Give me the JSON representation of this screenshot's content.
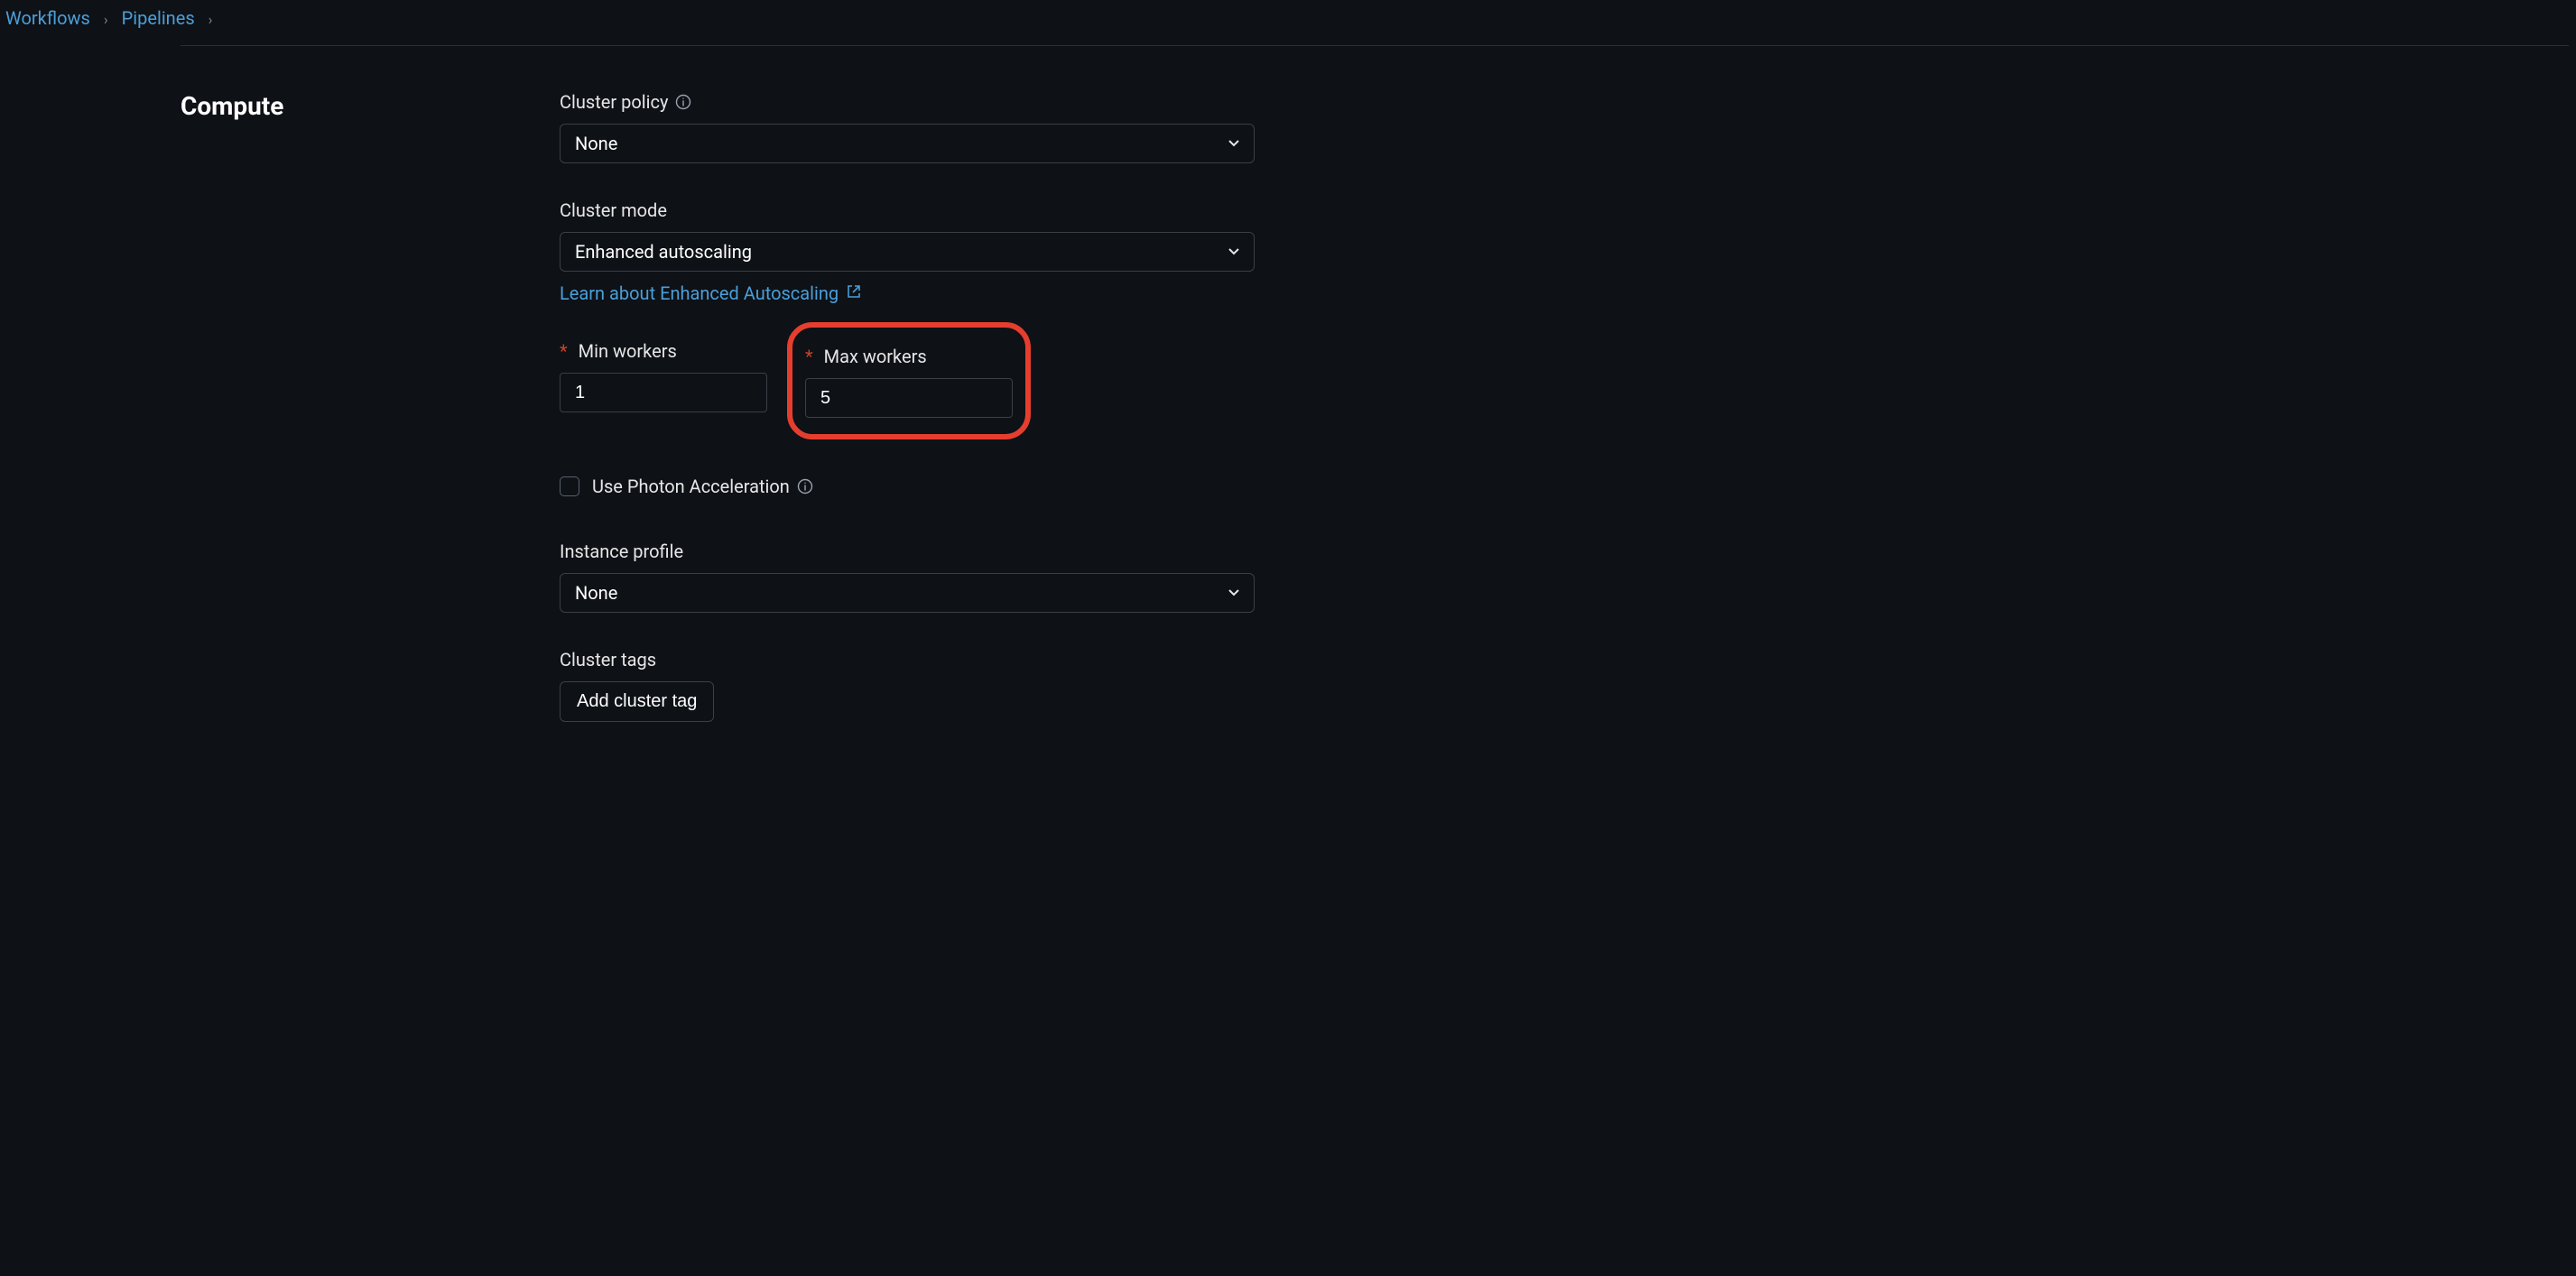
{
  "breadcrumb": {
    "items": [
      "Workflows",
      "Pipelines"
    ]
  },
  "section_title": "Compute",
  "cluster_policy": {
    "label": "Cluster policy",
    "value": "None"
  },
  "cluster_mode": {
    "label": "Cluster mode",
    "value": "Enhanced autoscaling",
    "link_text": "Learn about Enhanced Autoscaling"
  },
  "min_workers": {
    "label": "Min workers",
    "value": "1"
  },
  "max_workers": {
    "label": "Max workers",
    "value": "5"
  },
  "photon": {
    "label": "Use Photon Acceleration"
  },
  "instance_profile": {
    "label": "Instance profile",
    "value": "None"
  },
  "cluster_tags": {
    "label": "Cluster tags",
    "button": "Add cluster tag"
  }
}
